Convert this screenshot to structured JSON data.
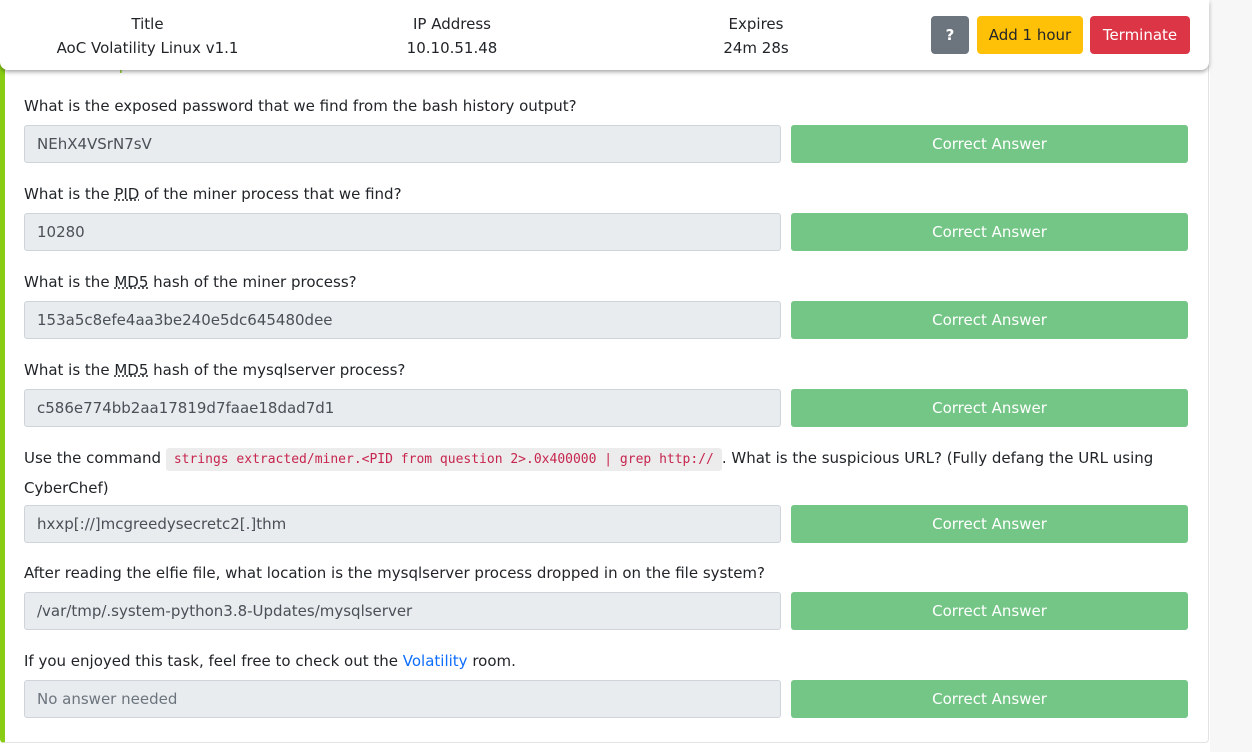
{
  "header": {
    "title_label": "Title",
    "title_value": "AoC Volatility Linux v1.1",
    "ip_label": "IP Address",
    "ip_value": "10.10.51.48",
    "expires_label": "Expires",
    "expires_value": "24m 28s",
    "help_label": "?",
    "add_hour_label": "Add 1 hour",
    "terminate_label": "Terminate"
  },
  "section_title": "Answer the questions below",
  "button_label": "Correct Answer",
  "questions": [
    {
      "text": "What is the exposed password that we find from the bash history output?",
      "answer": "NEhX4VSrN7sV"
    },
    {
      "pre": "What is the ",
      "abbr": "PID",
      "post": " of the miner process that we find?",
      "answer": "10280"
    },
    {
      "pre": "What is the ",
      "abbr": "MD5",
      "post": " hash of the miner process?",
      "answer": "153a5c8efe4aa3be240e5dc645480dee"
    },
    {
      "pre": "What is the ",
      "abbr": "MD5",
      "post": " hash of the mysqlserver process?",
      "answer": "c586e774bb2aa17819d7faae18dad7d1"
    },
    {
      "pre": "Use the command ",
      "code": "strings extracted/miner.<PID from question 2>.0x400000 | grep http://",
      "post": ". What is the suspicious URL? (Fully defang the URL using CyberChef)",
      "answer": "hxxp[://]mcgreedysecretc2[.]thm"
    },
    {
      "text": "After reading the elfie file, what location is the mysqlserver process dropped in on the file system?",
      "answer": "/var/tmp/.system-python3.8-Updates/mysqlserver"
    },
    {
      "pre": "If you enjoyed this task, feel free to check out the ",
      "link": "Volatility",
      "post": " room.",
      "placeholder": "No answer needed"
    }
  ]
}
